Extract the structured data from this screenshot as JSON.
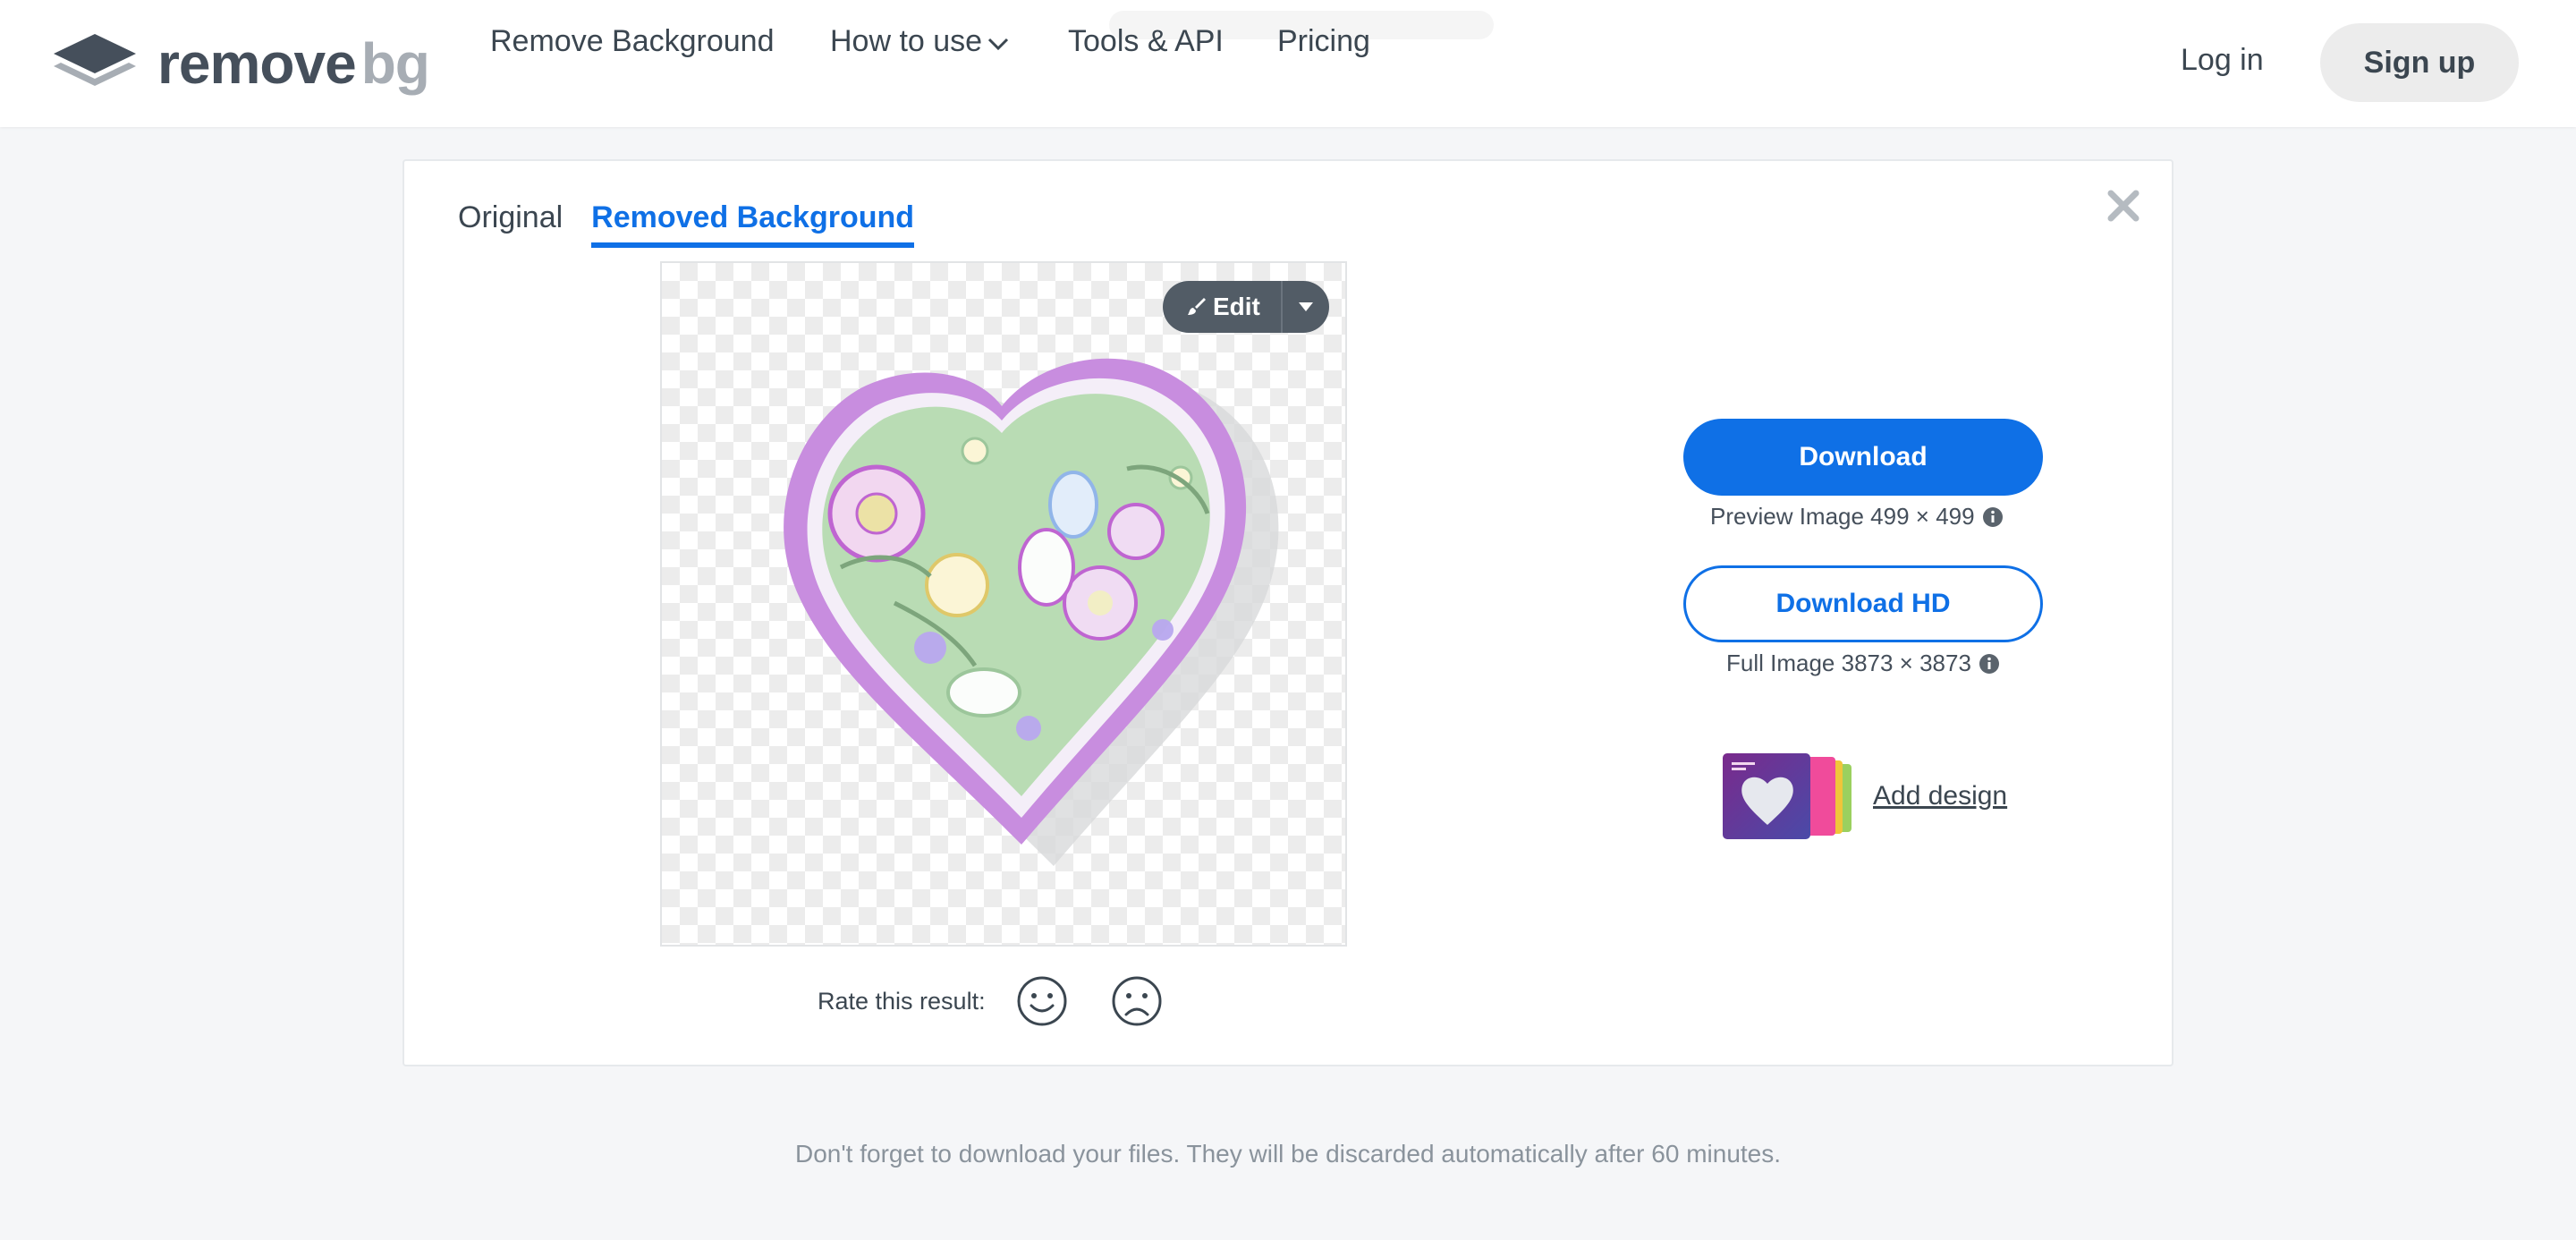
{
  "header": {
    "logo": {
      "word1": "remove",
      "word2": "bg"
    },
    "nav": [
      {
        "label": "Remove Background"
      },
      {
        "label": "How to use"
      },
      {
        "label": "Tools & API"
      },
      {
        "label": "Pricing"
      }
    ],
    "login": "Log in",
    "signup": "Sign up"
  },
  "card": {
    "tabs": [
      {
        "label": "Original",
        "active": false
      },
      {
        "label": "Removed Background",
        "active": true
      }
    ],
    "edit_button": "Edit",
    "rate_label": "Rate this result:",
    "download": {
      "primary_label": "Download",
      "preview_info": "Preview Image 499 × 499",
      "hd_label": "Download HD",
      "hd_info": "Full Image 3873 × 3873"
    },
    "add_design": "Add design"
  },
  "footer_note": "Don't forget to download your files. They will be discarded automatically after 60 minutes.",
  "colors": {
    "accent": "#0f70e6",
    "text": "#454f5b",
    "background": "#f5f6f8"
  },
  "icons": [
    "logo-layers-icon",
    "chevron-down-icon",
    "close-icon",
    "brush-icon",
    "caret-down-icon",
    "smile-icon",
    "frown-icon",
    "info-icon"
  ]
}
